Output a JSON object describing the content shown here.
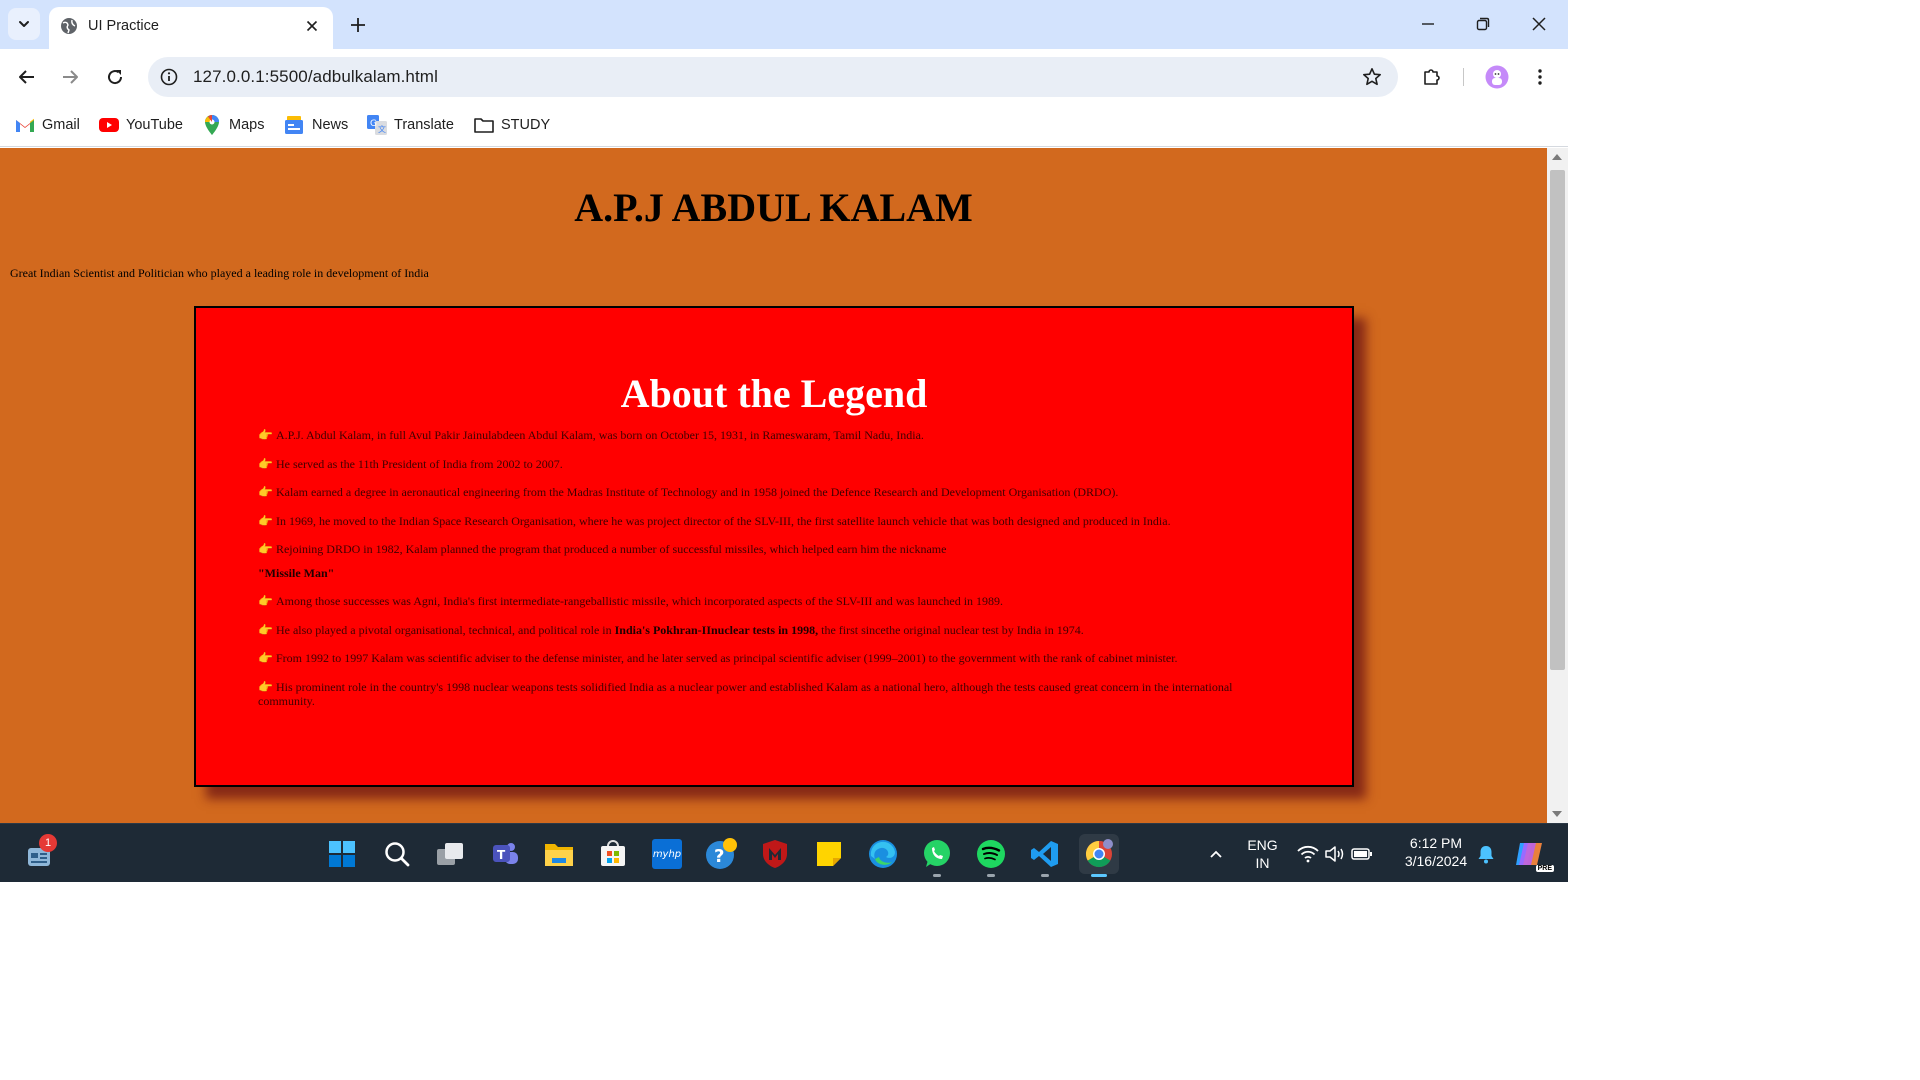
{
  "browser": {
    "tab": {
      "title": "UI Practice"
    },
    "address_bar": {
      "url": "127.0.0.1:5500/adbulkalam.html"
    },
    "bookmarks": [
      {
        "label": "Gmail",
        "icon": "gmail-icon"
      },
      {
        "label": "YouTube",
        "icon": "youtube-icon"
      },
      {
        "label": "Maps",
        "icon": "maps-icon"
      },
      {
        "label": "News",
        "icon": "news-icon"
      },
      {
        "label": "Translate",
        "icon": "translate-icon"
      },
      {
        "label": "STUDY",
        "icon": "folder-icon"
      }
    ]
  },
  "page": {
    "title": "A.P.J ABDUL KALAM",
    "subtitle": "Great Indian Scientist and Politician who played a leading role in development of India",
    "legend": {
      "heading": "About the Legend",
      "bullet": "👉",
      "facts": [
        "A.P.J. Abdul Kalam, in full Avul Pakir Jainulabdeen Abdul Kalam, was born on October 15, 1931, in Rameswaram, Tamil Nadu, India.",
        "He served as the 11th President of India from 2002 to 2007.",
        "Kalam earned a degree in aeronautical engineering from the Madras Institute of Technology and in 1958 joined the Defence Research and Development Organisation (DRDO).",
        "In 1969, he moved to the Indian Space Research Organisation, where he was project director of the SLV-III, the first satellite launch vehicle that was both designed and produced in India.",
        "Rejoining DRDO in 1982, Kalam planned the program that produced a number of successful missiles, which helped earn him the nickname"
      ],
      "nickname": "\"Missile Man\"",
      "fact_agni": "Among those successes was Agni, India's first intermediate-rangeballistic missile, which incorporated aspects of the SLV-III and was launched in 1989.",
      "fact_pokhran": {
        "before": "He also played a pivotal organisational, technical, and political role in ",
        "bold": "India's Pokhran-IInuclear tests in 1998,",
        "after": " the first sincethe original nuclear test by India in 1974."
      },
      "facts_end": [
        "From 1992 to 1997 Kalam was scientific adviser to the defense minister, and he later served as principal scientific adviser (1999–2001) to the government with the rank of cabinet minister.",
        "His prominent role in the country's 1998 nuclear weapons tests solidified India as a nuclear power and established Kalam as a national hero, although the tests caused great concern in the international community."
      ]
    }
  },
  "taskbar": {
    "widgets_badge": "1",
    "language": {
      "line1": "ENG",
      "line2": "IN"
    },
    "clock": {
      "time": "6:12 PM",
      "date": "3/16/2024"
    },
    "myhp_label": "myhp",
    "copilot_badge": "PRE",
    "apps": [
      "start-icon",
      "search-icon",
      "task-view-icon",
      "teams-icon",
      "file-explorer-icon",
      "microsoft-store-icon",
      "myhp-icon",
      "get-help-icon",
      "mcafee-icon",
      "sticky-notes-icon",
      "edge-icon",
      "whatsapp-icon",
      "spotify-icon",
      "vscode-icon",
      "chrome-icon"
    ]
  },
  "colors": {
    "page_background": "#d2691e",
    "legend_box": "#ff0000",
    "legend_heading": "#ffffff",
    "tab_strip": "#d3e3fd",
    "taskbar": "#1e2a36"
  }
}
